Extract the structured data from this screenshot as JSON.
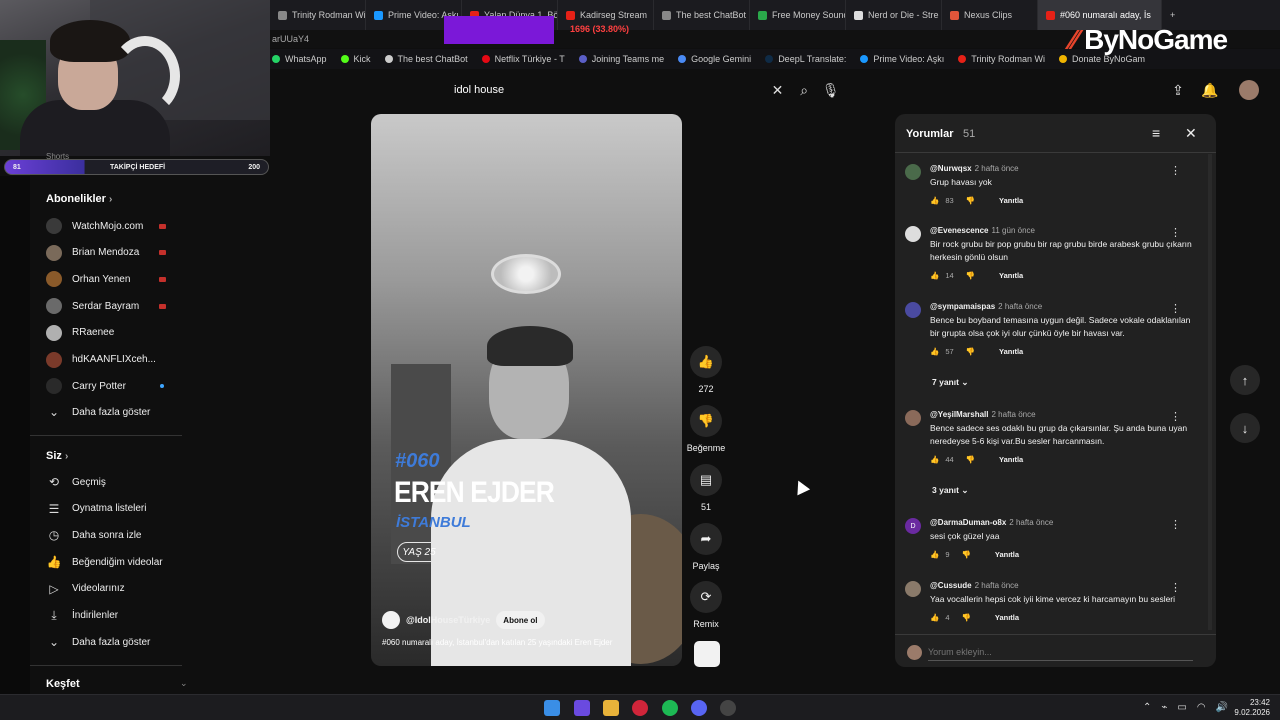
{
  "browser": {
    "tabs": [
      {
        "label": "Trinity Rodman Wi",
        "color": "#888888"
      },
      {
        "label": "Prime Video: Aşkı",
        "color": "#1a98ff"
      },
      {
        "label": "Yalan Dünya 1. Bö",
        "color": "#e62117"
      },
      {
        "label": "Kadirseg Stream",
        "color": "#e62117"
      },
      {
        "label": "The best ChatBot",
        "color": "#888888"
      },
      {
        "label": "Free Money Sound",
        "color": "#2aa84a"
      },
      {
        "label": "Nerd or Die - Stre",
        "color": "#dddddd"
      },
      {
        "label": "Nexus Clips",
        "color": "#e0553a"
      },
      {
        "label": "#060 numaralı aday, İs",
        "color": "#e62117",
        "active": true
      }
    ],
    "url_fragment": "arUUaY4",
    "bookmarks": [
      {
        "label": "WhatsApp",
        "color": "#25d366"
      },
      {
        "label": "Kick",
        "color": "#53fc18"
      },
      {
        "label": "The best ChatBot",
        "color": "#cccccc"
      },
      {
        "label": "Netflix Türkiye - T",
        "color": "#e50914"
      },
      {
        "label": "Joining Teams me",
        "color": "#5b5fc7"
      },
      {
        "label": "Google Gemini",
        "color": "#4a8af4"
      },
      {
        "label": "DeepL Translate:",
        "color": "#0f2b46"
      },
      {
        "label": "Prime Video: Aşkı",
        "color": "#1a98ff"
      },
      {
        "label": "Trinity Rodman Wi",
        "color": "#e62117"
      },
      {
        "label": "Donate ByNoGam",
        "color": "#f0b400"
      }
    ]
  },
  "stream_overlay": {
    "progress_text": "1696 (33.80%)",
    "logo": "ByNoGame",
    "follow_goal": {
      "label": "TAKİPÇİ HEDEFİ",
      "current": "81",
      "target": "200",
      "fraction": 0.3
    }
  },
  "search": {
    "query": "idol house"
  },
  "sidebar": {
    "shorts_label": "Shorts",
    "subscriptions_title": "Abonelikler",
    "subscriptions": [
      {
        "name": "WatchMojo.com",
        "status": "live",
        "color": "#3a3a3a"
      },
      {
        "name": "Brian Mendoza",
        "status": "live",
        "color": "#7a6a5a"
      },
      {
        "name": "Orhan Yenen",
        "status": "live",
        "color": "#8a5a2a"
      },
      {
        "name": "Serdar Bayram",
        "status": "live",
        "color": "#6a6a6a"
      },
      {
        "name": "RRaenee",
        "status": "",
        "color": "#b0b0b0"
      },
      {
        "name": "hdKAANFLIXceh...",
        "status": "new",
        "color": "#7a3a2a"
      },
      {
        "name": "Carry Potter",
        "status": "new",
        "color": "#2a2a2a"
      }
    ],
    "show_more": "Daha fazla göster",
    "you_title": "Siz",
    "you_items": [
      {
        "label": "Geçmiş",
        "icon": "history-icon"
      },
      {
        "label": "Oynatma listeleri",
        "icon": "playlist-icon"
      },
      {
        "label": "Daha sonra izle",
        "icon": "clock-icon"
      },
      {
        "label": "Beğendiğim videolar",
        "icon": "thumbs-up-icon"
      },
      {
        "label": "Videolarınız",
        "icon": "video-icon"
      },
      {
        "label": "İndirilenler",
        "icon": "download-icon"
      }
    ],
    "show_more_2": "Daha fazla göster",
    "explore_title": "Keşfet"
  },
  "video": {
    "number": "#060",
    "name": "EREN EJDER",
    "city": "İSTANBUL",
    "age": "YAŞ 25",
    "channel": "@IdolHouseTürkiye",
    "subscribe_label": "Abone ol",
    "description": "#060 numaralı aday, İstanbul'dan katılan 25 yaşındaki Eren Ejder"
  },
  "actions": {
    "likes": "272",
    "dislike_label": "Beğenme",
    "comments": "51",
    "share_label": "Paylaş",
    "remix_label": "Remix"
  },
  "comments_panel": {
    "title": "Yorumlar",
    "count": "51",
    "input_placeholder": "Yorum ekleyin...",
    "reply_label": "Yanıtla",
    "items": [
      {
        "user": "@Nurwqsx",
        "time": "2 hafta önce",
        "text": "Grup havası yok",
        "likes": "83",
        "color": "#4a6a4a"
      },
      {
        "user": "@Evenescence",
        "time": "11 gün önce",
        "text": "Bir rock grubu bir pop grubu bir rap grubu birde arabesk grubu çıkarın herkesin gönlü olsun",
        "likes": "14",
        "color": "#dddddd"
      },
      {
        "user": "@sympamaispas",
        "time": "2 hafta önce",
        "text": "Bence bu boyband temasına uygun değil. Sadece vokale odaklanılan bir grupta olsa çok iyi olur çünkü öyle bir havası var.",
        "likes": "57",
        "replies": "7 yanıt",
        "color": "#4a4aa0"
      },
      {
        "user": "@YeşilMarshall",
        "time": "2 hafta önce",
        "text": "Bence sadece ses odaklı bu grup da çıkarsınlar. Şu anda buna uyan neredeyse 5-6 kişi var.Bu sesler harcanmasın.",
        "likes": "44",
        "replies": "3 yanıt",
        "color": "#8a6a5a"
      },
      {
        "user": "@DarmaDuman-o8x",
        "time": "2 hafta önce",
        "text": "sesi çok güzel yaa",
        "likes": "9",
        "avatar_letter": "D",
        "color": "#6a2aa0"
      },
      {
        "user": "@Cussude",
        "time": "2 hafta önce",
        "text": "Yaa vocallerin hepsi cok iyii kime vercez ki harcamayın bu sesleri",
        "likes": "4",
        "color": "#8a7a6a"
      }
    ]
  },
  "taskbar": {
    "time": "23:42",
    "date": "9.02.2026"
  }
}
